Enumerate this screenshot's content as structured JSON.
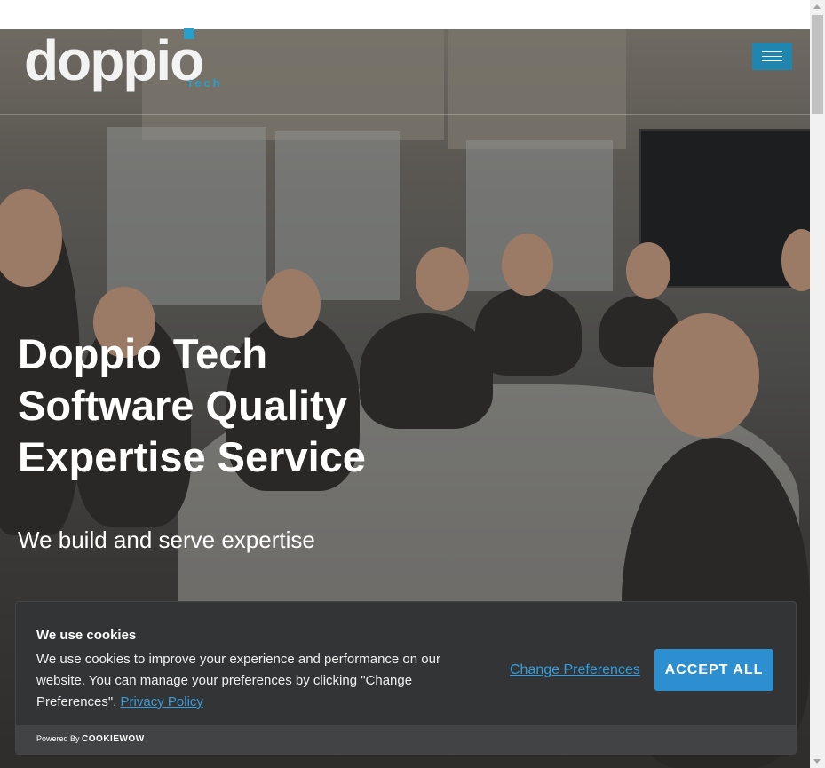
{
  "brand": {
    "logo_text": "doppio",
    "logo_sub": "tech",
    "accent_color": "#1f86b0"
  },
  "nav": {
    "menu_icon": "hamburger-icon"
  },
  "hero": {
    "title_line1": "Doppio Tech",
    "title_line2": "Software Quality",
    "title_line3": "Expertise Service",
    "subtitle": "We build and serve expertise"
  },
  "cookie_banner": {
    "title": "We use cookies",
    "text": "We use cookies to improve your experience and performance on our website. You can manage your preferences by clicking \"Change Preferences\". ",
    "privacy_link": "Privacy Policy",
    "change_preferences": "Change Preferences",
    "accept_all": "ACCEPT ALL",
    "powered_by": "Powered By",
    "powered_brand": "COOKIEWOW"
  }
}
